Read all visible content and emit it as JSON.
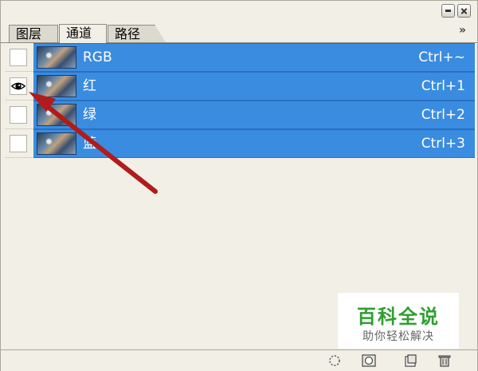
{
  "panel": {
    "tabs": [
      {
        "label": "图层",
        "active": false
      },
      {
        "label": "通道",
        "active": true
      },
      {
        "label": "路径",
        "active": false
      }
    ],
    "menu_arrows": "»"
  },
  "channels": [
    {
      "name": "RGB",
      "shortcut": "Ctrl+~",
      "visible": false,
      "selected": true
    },
    {
      "name": "红",
      "shortcut": "Ctrl+1",
      "visible": true,
      "selected": true
    },
    {
      "name": "绿",
      "shortcut": "Ctrl+2",
      "visible": false,
      "selected": true
    },
    {
      "name": "蓝",
      "shortcut": "Ctrl+3",
      "visible": false,
      "selected": true
    }
  ],
  "bottom_icons": [
    "load-selection-icon",
    "save-selection-icon",
    "new-channel-icon",
    "trash-icon"
  ],
  "watermark": {
    "title": "百科全说",
    "subtitle": "助你轻松解决"
  },
  "colors": {
    "selection": "#3a8ce0",
    "panel_bg": "#f1efe6",
    "arrow": "#b01c1c",
    "watermark_green": "#2f9e2f"
  }
}
